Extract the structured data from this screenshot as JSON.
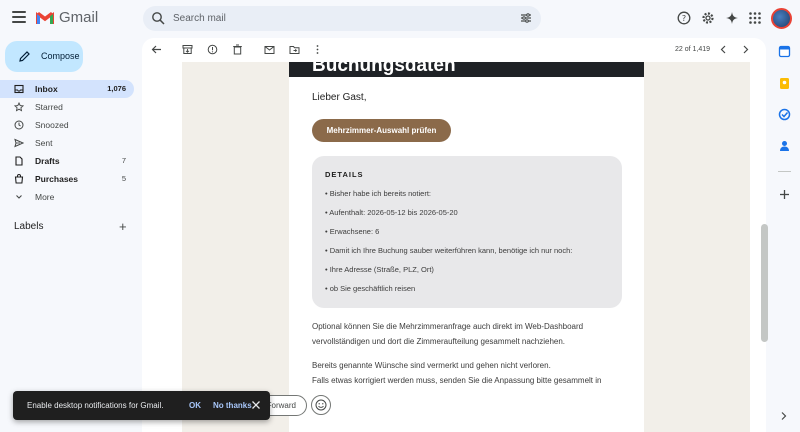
{
  "app": {
    "logo_text": "Gmail",
    "colors": {
      "accent": "#0b57d0",
      "compose_bg": "#c2e7ff",
      "active_nav": "#d3e3fd",
      "cta": "#8b6a4a"
    }
  },
  "search": {
    "placeholder": "Search mail"
  },
  "compose": {
    "label": "Compose"
  },
  "nav": {
    "items": [
      {
        "label": "Inbox",
        "count": "1,076",
        "icon": "inbox-icon"
      },
      {
        "label": "Starred",
        "count": "",
        "icon": "star-icon"
      },
      {
        "label": "Snoozed",
        "count": "",
        "icon": "clock-icon"
      },
      {
        "label": "Sent",
        "count": "",
        "icon": "send-icon"
      },
      {
        "label": "Drafts",
        "count": "7",
        "icon": "draft-icon"
      },
      {
        "label": "Purchases",
        "count": "5",
        "icon": "tag-icon"
      },
      {
        "label": "More",
        "count": "",
        "icon": "chevron-down-icon"
      }
    ],
    "labels_heading": "Labels"
  },
  "toolbar": {
    "pager": "22 of 1,419"
  },
  "email": {
    "header_title": "Buchungsdaten",
    "greeting": "Lieber Gast,",
    "cta_label": "Mehrzimmer-Auswahl prüfen",
    "details": {
      "heading": "DETAILS",
      "lines": [
        "• Bisher habe ich bereits notiert:",
        "• Aufenthalt: 2026-05-12 bis 2026-05-20",
        "• Erwachsene: 6",
        "• Damit ich Ihre Buchung sauber weiterführen kann, benötige ich nur noch:",
        "• Ihre Adresse (Straße, PLZ, Ort)",
        "• ob Sie geschäftlich reisen"
      ]
    },
    "paragraphs": [
      "Optional können Sie die Mehrzimmeranfrage auch direkt im Web-Dashboard vervollständigen und dort die Zimmeraufteilung gesammelt nachziehen.",
      "Bereits genannte Wünsche sind vermerkt und gehen nicht verloren.",
      "Falls etwas korrigiert werden muss, senden Sie die Anpassung bitte gesammelt in"
    ]
  },
  "reply": {
    "forward_label": "Forward"
  },
  "toast": {
    "message": "Enable desktop notifications for Gmail.",
    "ok": "OK",
    "no_thanks": "No thanks"
  }
}
